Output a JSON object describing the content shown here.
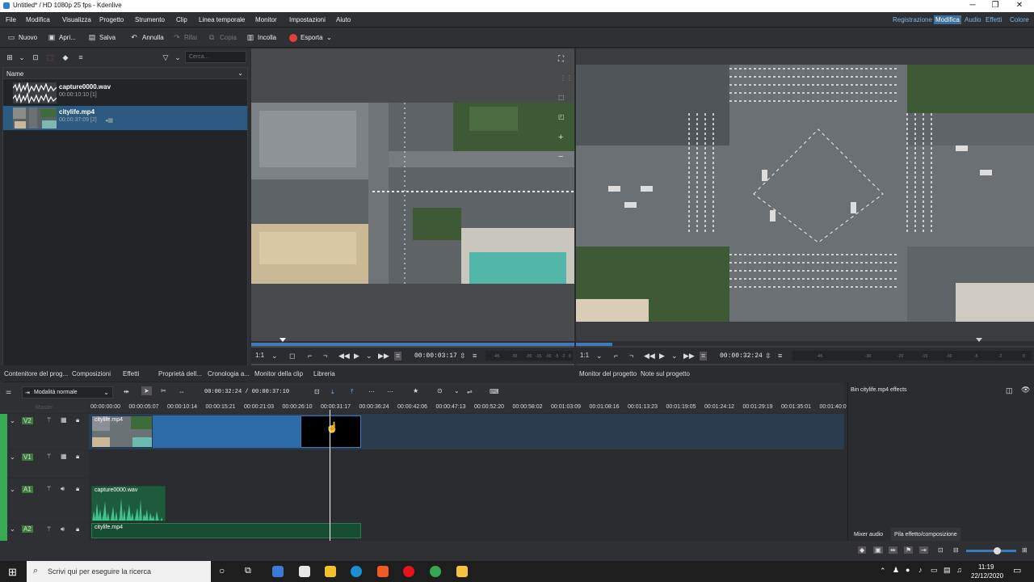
{
  "window": {
    "title": "Untitled* / HD 1080p 25 fps - Kdenlive",
    "minimize": "─",
    "maximize": "❐",
    "close": "✕"
  },
  "menu": [
    "File",
    "Modifica",
    "Visualizza",
    "Progetto",
    "Strumento",
    "Clip",
    "Linea temporale",
    "Monitor",
    "Impostazioni",
    "Aiuto"
  ],
  "workspaces": [
    "Registrazione",
    "Modifica",
    "Audio",
    "Effetti",
    "Colore"
  ],
  "toolbar": {
    "new": "Nuovo",
    "open": "Apri...",
    "save": "Salva",
    "undo": "Annulla",
    "redo": "Rifai",
    "copy": "Copia",
    "paste": "Incolla",
    "export": "Esporta"
  },
  "bin": {
    "search_placeholder": "Cerca...",
    "column": "Name",
    "items": [
      {
        "name": "capture0000.wav",
        "duration": "00:00:10:10 [1]"
      },
      {
        "name": "citylife.mp4",
        "duration": "00:00:37:09 [2]"
      }
    ]
  },
  "left_tabs": [
    "Contenitore del prog...",
    "Composizioni",
    "Effetti",
    "Proprietà dell...",
    "Cronologia a..."
  ],
  "clip_monitor": {
    "zoom": "1:1",
    "timecode": "00:00:03:17",
    "tab1": "Monitor della clip",
    "tab2": "Libreria",
    "meter": [
      "-45",
      "-30",
      "-20",
      "-15",
      "-10",
      "-5",
      "-2",
      "0"
    ]
  },
  "project_monitor": {
    "zoom": "1:1",
    "timecode": "00:00:32:24",
    "tab1": "Monitor del progetto",
    "tab2": "Note sul progetto",
    "meter": [
      "-45",
      "-30",
      "-20",
      "-15",
      "-10",
      "-5",
      "-2",
      "0"
    ]
  },
  "timeline": {
    "mode": "Modalità normale",
    "position": "00:00:32:24 / 00:00:37:10",
    "ruler": [
      "00:00:00:00",
      "00:00:05:07",
      "00:00:10:14",
      "00:00:15:21",
      "00:00:21:03",
      "00:00:26:10",
      "00:00:31:17",
      "00:00:36:24",
      "00:00:42:06",
      "00:00:47:13",
      "00:00:52:20",
      "00:00:58:02",
      "00:01:03:09",
      "00:01:08:16",
      "00:01:13:23",
      "00:01:19:05",
      "00:01:24:12",
      "00:01:29:19",
      "00:01:35:01",
      "00:01:40:0"
    ],
    "master": "Master",
    "tracks": [
      {
        "id": "V2"
      },
      {
        "id": "V1"
      },
      {
        "id": "A1"
      },
      {
        "id": "A2"
      }
    ],
    "clips": {
      "v2": "citylife.mp4",
      "a1": "capture0000.wav",
      "a2": "citylife.mp4"
    }
  },
  "effects_panel": {
    "title": "Bin citylife.mp4 effects",
    "tab1": "Mixer audio",
    "tab2": "Pila effetto/composizione"
  },
  "taskbar": {
    "search": "Scrivi qui per eseguire la ricerca",
    "time": "11:19",
    "date": "22/12/2020"
  }
}
